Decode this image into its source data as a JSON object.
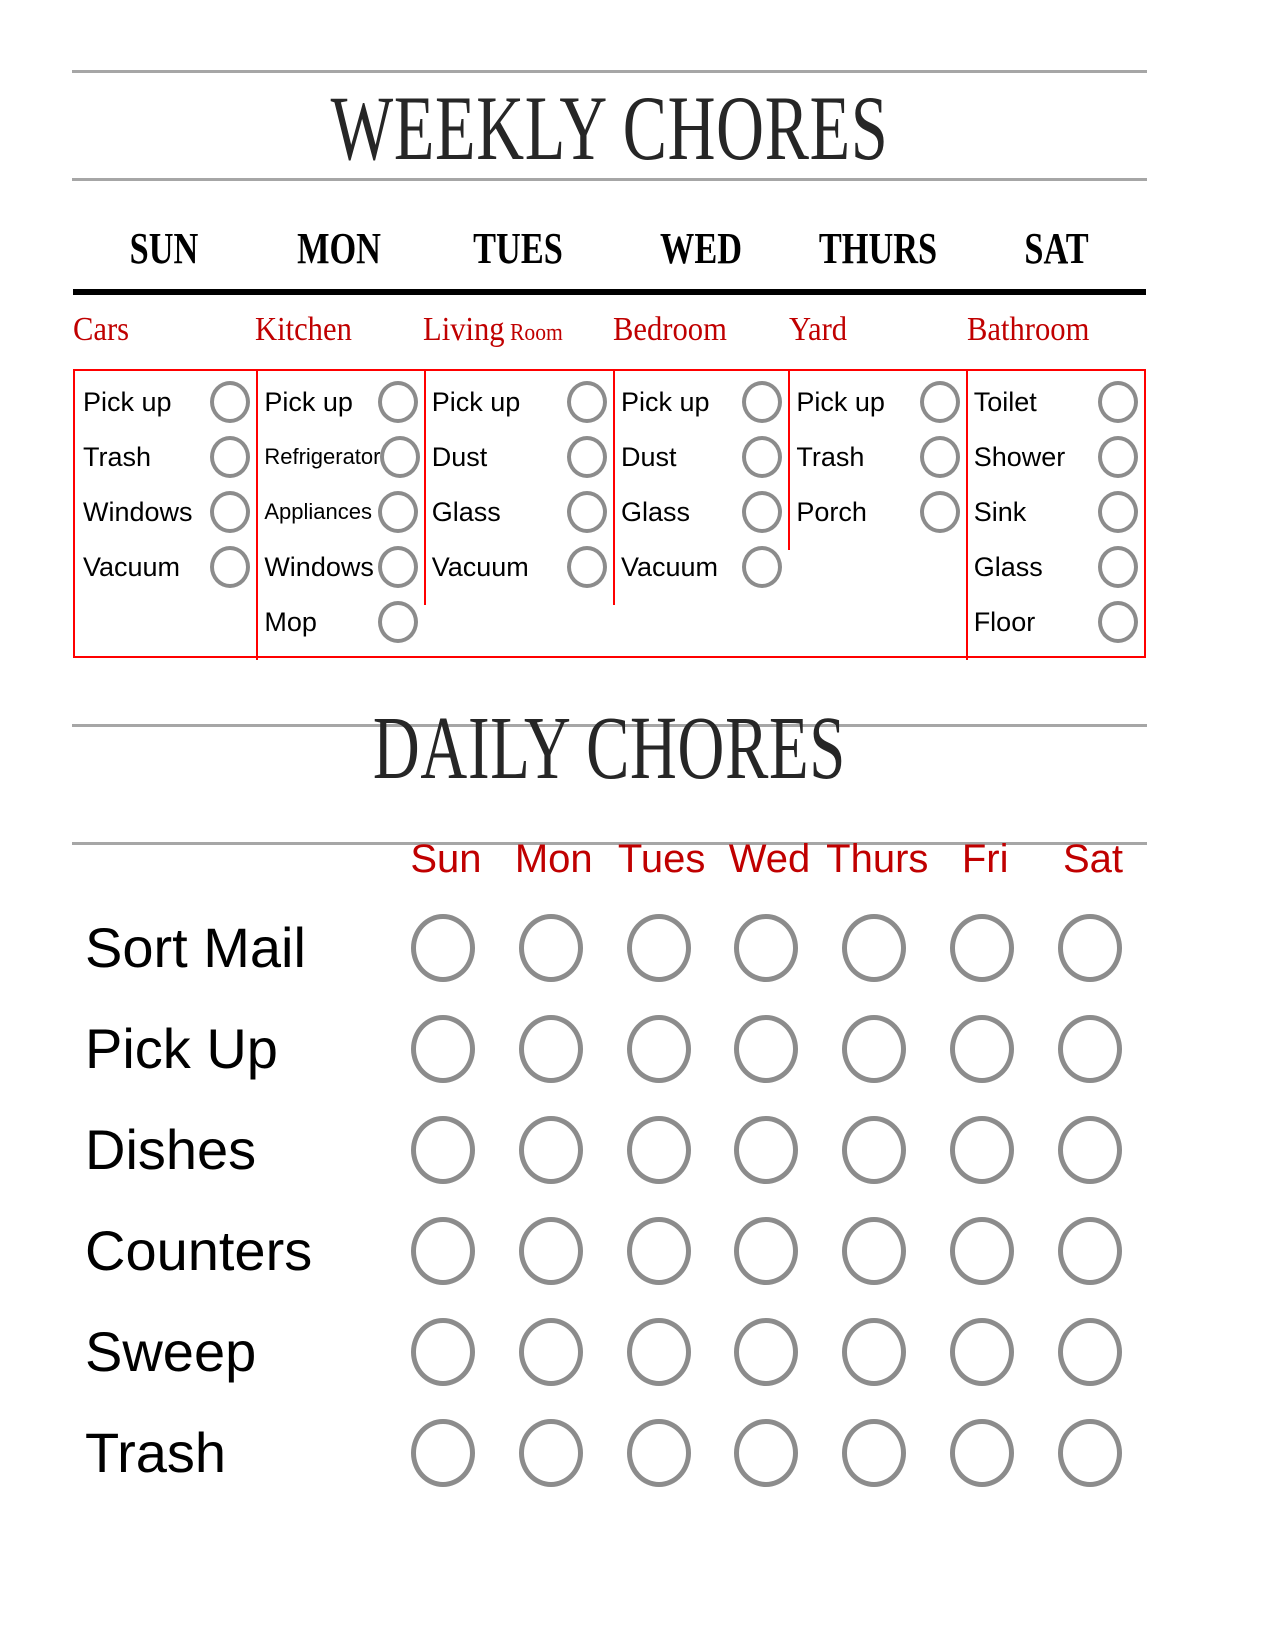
{
  "colors": {
    "red_accent": "#c00000",
    "box_red": "#ff0000",
    "circle_gray": "#8c8c8c",
    "rule_gray": "#a6a6a6",
    "title_dark": "#262626"
  },
  "weekly": {
    "title": "WEEKLY CHORES",
    "day_headers": [
      "SUN",
      "MON",
      "TUES",
      "WED",
      "THURS",
      "SAT"
    ],
    "columns": [
      {
        "category": "Cars",
        "category_suffix": "",
        "items": [
          "Pick up",
          "Trash",
          "Windows",
          "Vacuum"
        ]
      },
      {
        "category": "Kitchen",
        "category_suffix": "",
        "items": [
          "Pick up",
          "Refrigerator",
          "Appliances",
          "Windows",
          "Mop"
        ]
      },
      {
        "category": "Living",
        "category_suffix": "Room",
        "items": [
          "Pick up",
          "Dust",
          "Glass",
          "Vacuum"
        ]
      },
      {
        "category": "Bedroom",
        "category_suffix": "",
        "items": [
          "Pick up",
          "Dust",
          "Glass",
          "Vacuum"
        ]
      },
      {
        "category": "Yard",
        "category_suffix": "",
        "items": [
          "Pick up",
          "Trash",
          "Porch"
        ]
      },
      {
        "category": "Bathroom",
        "category_suffix": "",
        "items": [
          "Toilet",
          "Shower",
          "Sink",
          "Glass",
          "Floor"
        ]
      }
    ]
  },
  "daily": {
    "title": "DAILY CHORES",
    "day_headers": [
      "Sun",
      "Mon",
      "Tues",
      "Wed",
      "Thurs",
      "Fri",
      "Sat"
    ],
    "chores": [
      "Sort Mail",
      "Pick Up",
      "Dishes",
      "Counters",
      "Sweep",
      "Trash"
    ]
  }
}
